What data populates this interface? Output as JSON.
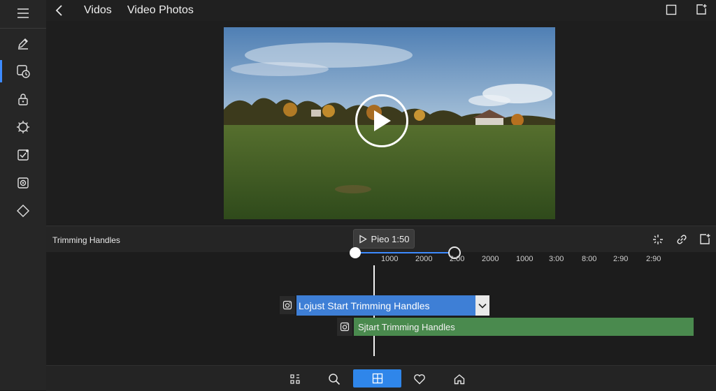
{
  "header": {
    "crumb_1": "Vidos",
    "crumb_2": "Video Photos"
  },
  "sidebar": {
    "items": [
      {
        "icon": "edit-pen-icon"
      },
      {
        "icon": "clip-timer-icon",
        "active": true
      },
      {
        "icon": "lock-icon"
      },
      {
        "icon": "settings-gear-icon"
      },
      {
        "icon": "checkbox-icon"
      },
      {
        "icon": "camera-capture-icon"
      },
      {
        "icon": "diamond-icon"
      }
    ]
  },
  "trim": {
    "title": "Trimming Handles",
    "play_label": "Pieo 1:50"
  },
  "ruler": {
    "ticks": [
      "1000",
      "2000",
      "2:00",
      "2000",
      "1000",
      "3:00",
      "8:00",
      "2:90",
      "2:90"
    ]
  },
  "clips": {
    "top_label": "Lojust Start Trimming Handles",
    "bottom_label": "Sjtart Trimming Handles"
  },
  "colors": {
    "accent": "#3d8bff",
    "clip_blue": "#3e7fd6",
    "clip_green": "#4a8a4e",
    "nav_active": "#2f86ea"
  }
}
